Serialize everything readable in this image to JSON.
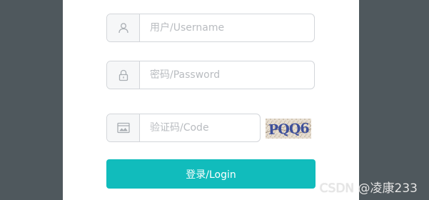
{
  "form": {
    "username": {
      "placeholder": "用户/Username",
      "value": "",
      "icon": "user-icon"
    },
    "password": {
      "placeholder": "密码/Password",
      "value": "",
      "icon": "lock-icon"
    },
    "code": {
      "placeholder": "验证码/Code",
      "value": "",
      "icon": "image-icon"
    },
    "captcha": {
      "text": "PQQ6"
    },
    "login_label": "登录/Login"
  },
  "watermark": {
    "text": "CSDN @凌康233"
  },
  "colors": {
    "background": "#4f585d",
    "panel": "#ffffff",
    "accent": "#11bcbc",
    "border": "#d3d6da",
    "addon_bg": "#f6f7f8",
    "placeholder": "#b9bcc0"
  }
}
